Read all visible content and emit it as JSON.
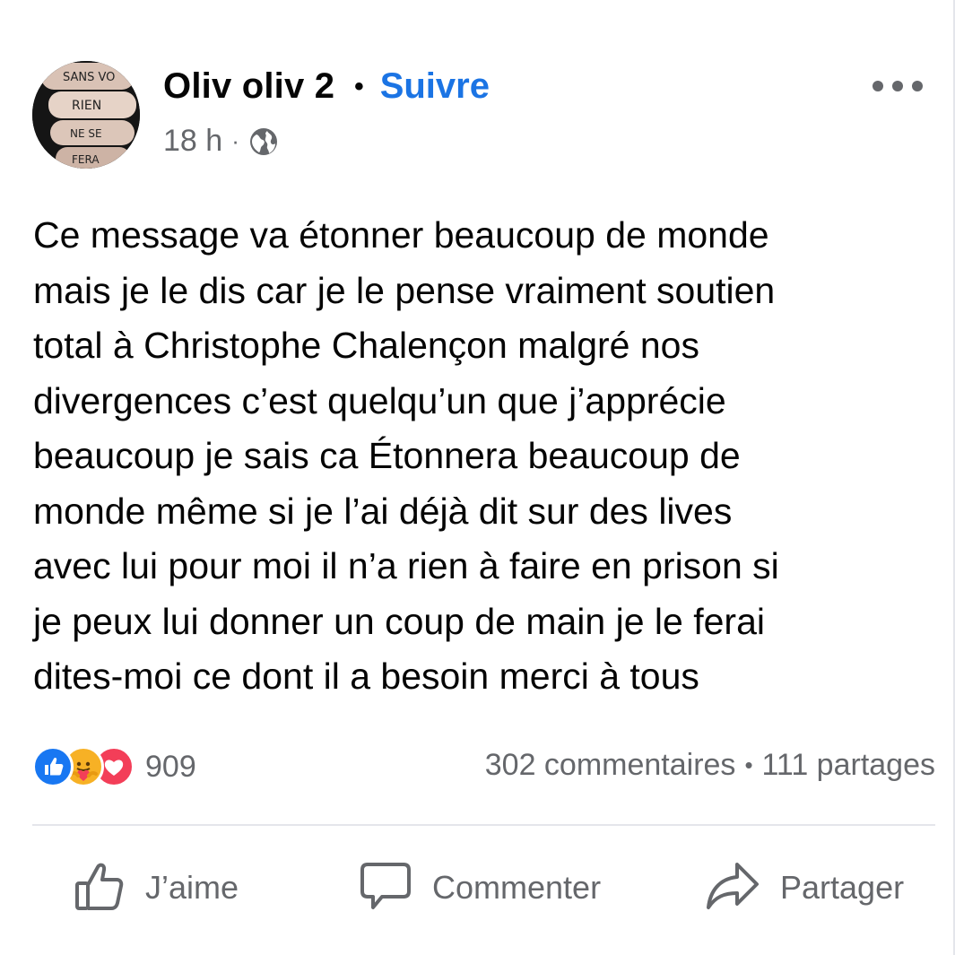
{
  "post": {
    "author": "Oliv oliv 2",
    "follow_label": "Suivre",
    "time": "18 h",
    "meta_separator": "·",
    "header_separator": "•",
    "avatar_text": [
      "SANS VO",
      "RIEN",
      "NE SE",
      "FERA"
    ],
    "text": "Ce message va étonner beaucoup de monde\nmais je le dis car je le pense vraiment soutien\ntotal à Christophe Chalençon malgré nos\ndivergences c’est quelqu’un que j’apprécie\nbeaucoup je sais ca Étonnera beaucoup de\nmonde même si je l’ai déjà dit sur des lives\navec lui pour moi il n’a rien à faire en prison si\nje peux lui donner un coup de main je le ferai\ndites-moi ce dont il a besoin merci à tous"
  },
  "stats": {
    "reaction_count": "909",
    "comments": "302 commentaires",
    "stats_separator": "•",
    "shares": "111 partages"
  },
  "actions": {
    "like": "J’aime",
    "comment": "Commenter",
    "share": "Partager"
  },
  "icons": {
    "reactions": [
      "like-reaction-icon",
      "care-reaction-icon",
      "love-reaction-icon"
    ],
    "privacy": "globe-icon",
    "menu": "more-options-icon"
  },
  "colors": {
    "accent": "#1b74e4",
    "secondary_text": "#65676b",
    "like": "#1877f2",
    "care": "#f7b125",
    "love": "#f33e58"
  }
}
